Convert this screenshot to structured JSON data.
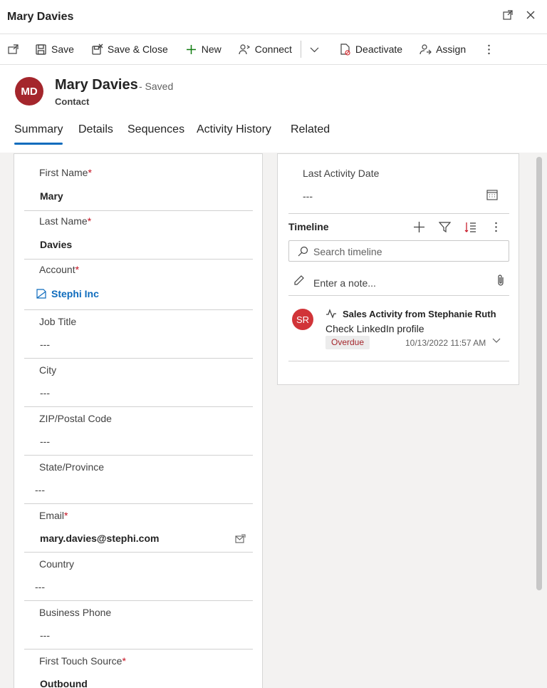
{
  "window": {
    "title": "Mary Davies"
  },
  "commands": {
    "save": "Save",
    "save_close": "Save & Close",
    "new": "New",
    "connect": "Connect",
    "deactivate": "Deactivate",
    "assign": "Assign"
  },
  "record": {
    "avatar_initials": "MD",
    "name": "Mary Davies",
    "status": "- Saved",
    "entity_type": "Contact"
  },
  "tabs": [
    "Summary",
    "Details",
    "Sequences",
    "Activity History",
    "Related"
  ],
  "fields": {
    "first_name": {
      "label": "First Name",
      "value": "Mary"
    },
    "last_name": {
      "label": "Last Name",
      "value": "Davies"
    },
    "account": {
      "label": "Account",
      "value": "Stephi Inc"
    },
    "job_title": {
      "label": "Job Title",
      "value": "---"
    },
    "city": {
      "label": "City",
      "value": "---"
    },
    "zip": {
      "label": "ZIP/Postal Code",
      "value": "---"
    },
    "state": {
      "label": "State/Province",
      "value": "---"
    },
    "email": {
      "label": "Email",
      "value": "mary.davies@stephi.com"
    },
    "country": {
      "label": "Country",
      "value": "---"
    },
    "business_phone": {
      "label": "Business Phone",
      "value": "---"
    },
    "first_touch": {
      "label": "First Touch Source",
      "value": "Outbound"
    }
  },
  "required_marker": "*",
  "right": {
    "last_activity_label": "Last Activity Date",
    "last_activity_value": "---",
    "timeline_title": "Timeline",
    "search_placeholder": "Search timeline",
    "note_placeholder": "Enter a note...",
    "activity": {
      "avatar_initials": "SR",
      "title": "Sales Activity from Stephanie Ruth",
      "subtitle": "Check LinkedIn profile",
      "badge": "Overdue",
      "timestamp": "10/13/2022 11:57 AM"
    }
  },
  "colors": {
    "accent": "#0f6cbd",
    "avatar_md": "#a4262c",
    "avatar_sr": "#d13438",
    "required": "#c50f1f"
  }
}
